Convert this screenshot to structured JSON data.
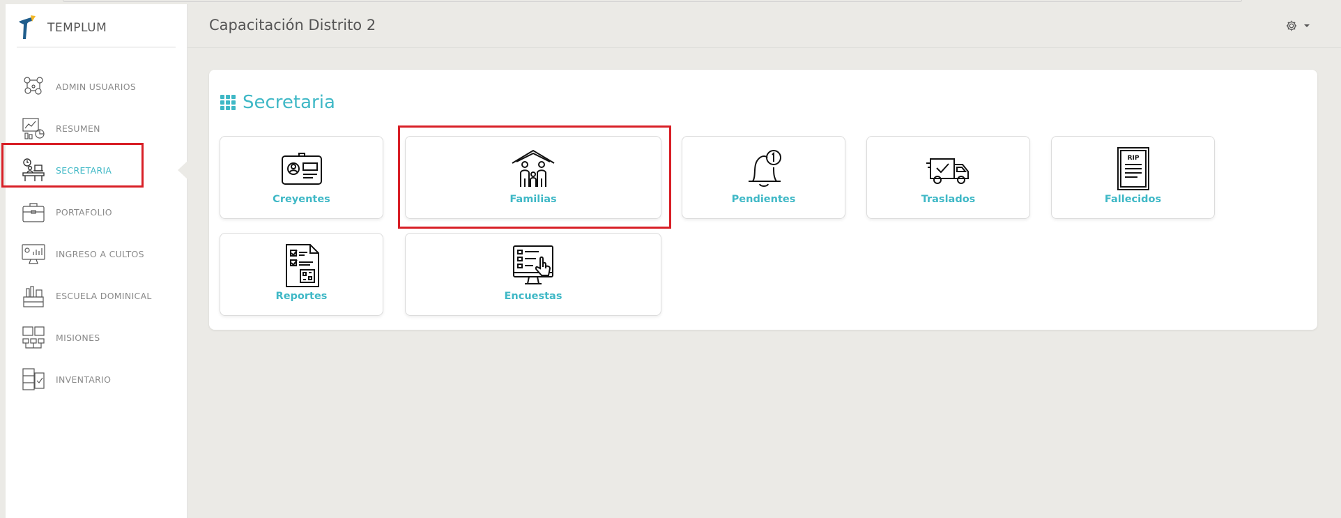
{
  "brand": {
    "name": "TEMPLUM"
  },
  "sidebar": {
    "items": [
      {
        "label": "ADMIN USUARIOS",
        "icon": "users-network-icon"
      },
      {
        "label": "RESUMEN",
        "icon": "report-chart-icon"
      },
      {
        "label": "SECRETARIA",
        "icon": "desk-clock-icon"
      },
      {
        "label": "PORTAFOLIO",
        "icon": "briefcase-icon"
      },
      {
        "label": "INGRESO A CULTOS",
        "icon": "monitor-stats-icon"
      },
      {
        "label": "ESCUELA DOMINICAL",
        "icon": "school-desk-icon"
      },
      {
        "label": "MISIONES",
        "icon": "mission-board-icon"
      },
      {
        "label": "INVENTARIO",
        "icon": "inventory-icon"
      }
    ],
    "active": "SECRETARIA"
  },
  "header": {
    "title": "Capacitación Distrito 2"
  },
  "section": {
    "title": "Secretaria"
  },
  "tiles": [
    {
      "label": "Creyentes",
      "icon": "id-card-icon"
    },
    {
      "label": "Familias",
      "icon": "family-house-icon"
    },
    {
      "label": "Pendientes",
      "icon": "bell-notification-icon"
    },
    {
      "label": "Traslados",
      "icon": "delivery-truck-icon"
    },
    {
      "label": "Fallecidos",
      "icon": "rip-document-icon"
    },
    {
      "label": "Reportes",
      "icon": "report-document-icon"
    },
    {
      "label": "Encuestas",
      "icon": "survey-monitor-icon"
    }
  ],
  "colors": {
    "accent": "#3fb8c6",
    "highlight": "#d81f26",
    "background": "#ebeae6"
  }
}
